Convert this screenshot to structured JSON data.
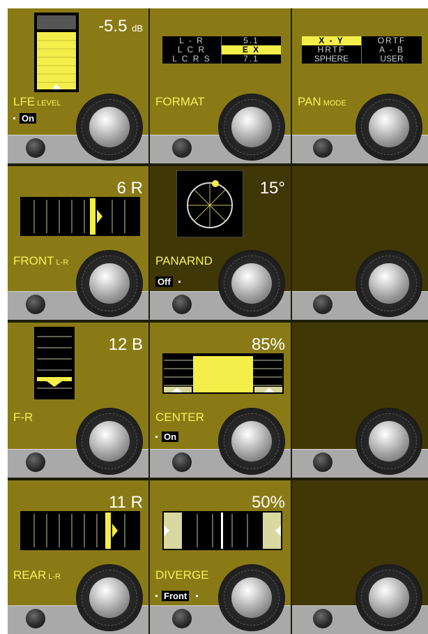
{
  "row1": {
    "lfe": {
      "value": "-5.5",
      "unit": "dB",
      "label": "LFE",
      "sub": "LEVEL",
      "flag": "On",
      "level": 0.52
    },
    "format": {
      "label": "FORMAT",
      "options": [
        "L - R",
        "5.1",
        "L C R",
        "E X",
        "L C R S",
        "7.1"
      ],
      "selected": "E X"
    },
    "pan": {
      "label": "PAN",
      "sub": "MODE",
      "options": [
        "X - Y",
        "ORTF",
        "HRTF",
        "A - B",
        "SPHERE",
        "USER"
      ],
      "selected": "X - Y"
    }
  },
  "row2": {
    "front": {
      "value": "6 R",
      "label": "FRONT",
      "sub": "L-R",
      "position": 0.58
    },
    "panarnd": {
      "value": "15°",
      "label": "PANARND",
      "flag": "Off",
      "angle_deg": 15
    },
    "empty": {}
  },
  "row3": {
    "fr": {
      "value": "12 B",
      "label": "F-R",
      "position": 0.62
    },
    "center": {
      "value": "85%",
      "label": "CENTER",
      "flag": "On",
      "level": 0.85
    },
    "empty": {}
  },
  "row4": {
    "rear": {
      "value": "11 R",
      "label": "REAR",
      "sub": "L-R",
      "position": 0.72
    },
    "diverge": {
      "value": "50%",
      "label": "DIVERGE",
      "flag": "Front",
      "level": 0.5
    },
    "empty": {}
  },
  "colors": {
    "panel": "#8a7a16",
    "panel_dim": "#403707",
    "accent": "#f4ee4a",
    "rail": "#a9a9a9"
  }
}
